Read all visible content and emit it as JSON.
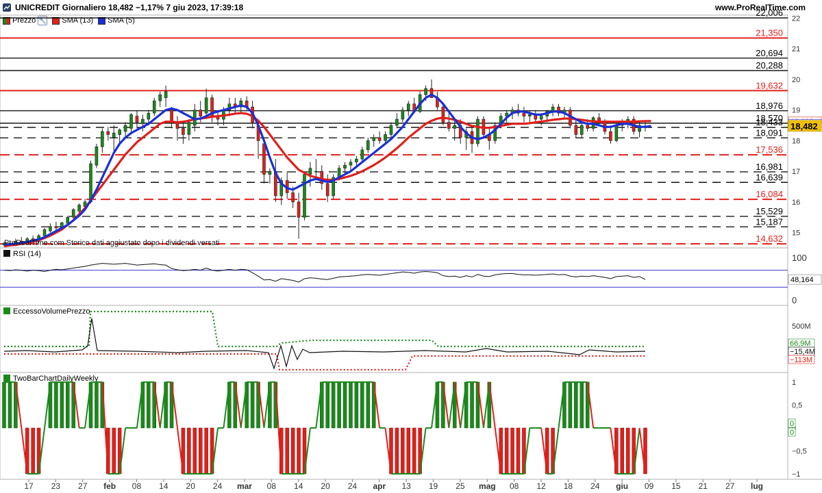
{
  "header": {
    "title": "UNICREDIT Giornaliero 18,482 −1,17% 7 giu 2023, 17:39:18",
    "site": "www.ProRealTime.com"
  },
  "legend": {
    "price": "Prezzo",
    "sma13": "SMA (13)",
    "sma5": "SMA (5)",
    "watermark": "ProRealTime.com Storico dati aggiustato dopo i dividendi versati"
  },
  "colors": {
    "up": "#1a8a1a",
    "down": "#e0201a",
    "sma13": "#e0201a",
    "sma5": "#1a2fd6",
    "current": "#f2c200"
  },
  "chart_data": [
    {
      "type": "candlestick",
      "title": "UNICREDIT Giornaliero",
      "ylim": [
        14.5,
        22.1
      ],
      "yticks": [
        15,
        16,
        17,
        18,
        19,
        20,
        21,
        22
      ],
      "last": "18,482",
      "x_labels": [
        "17",
        "23",
        "27",
        "feb",
        "08",
        "14",
        "20",
        "24",
        "mar",
        "08",
        "14",
        "20",
        "24",
        "apr",
        "13",
        "19",
        "25",
        "mag",
        "08",
        "12",
        "18",
        "24",
        "giu",
        "09",
        "15",
        "21",
        "27",
        "lug"
      ],
      "levels": [
        {
          "label": "22,006",
          "value": 22.006,
          "color": "black",
          "style": "solid"
        },
        {
          "label": "21,350",
          "value": 21.35,
          "color": "red",
          "style": "solid"
        },
        {
          "label": "20,694",
          "value": 20.694,
          "color": "black",
          "style": "solid"
        },
        {
          "label": "20,288",
          "value": 20.288,
          "color": "black",
          "style": "solid"
        },
        {
          "label": "19,632",
          "value": 19.632,
          "color": "red",
          "style": "solid"
        },
        {
          "label": "18,976",
          "value": 18.976,
          "color": "black",
          "style": "solid"
        },
        {
          "label": "18,570",
          "value": 18.57,
          "color": "black",
          "style": "solid"
        },
        {
          "label": "18,433",
          "value": 18.433,
          "color": "black",
          "style": "dashed"
        },
        {
          "label": "18,091",
          "value": 18.091,
          "color": "black",
          "style": "dashed"
        },
        {
          "label": "17,536",
          "value": 17.536,
          "color": "red",
          "style": "dashed"
        },
        {
          "label": "16,981",
          "value": 16.981,
          "color": "black",
          "style": "dashed"
        },
        {
          "label": "16,639",
          "value": 16.639,
          "color": "black",
          "style": "dashed"
        },
        {
          "label": "16,084",
          "value": 16.084,
          "color": "red",
          "style": "dashed"
        },
        {
          "label": "15,529",
          "value": 15.529,
          "color": "black",
          "style": "dashed"
        },
        {
          "label": "15,187",
          "value": 15.187,
          "color": "black",
          "style": "dashed"
        },
        {
          "label": "14,632",
          "value": 14.632,
          "color": "red",
          "style": "dashed"
        }
      ],
      "right_tags": [
        {
          "label": "18,638",
          "value": 18.638,
          "color": "#e0201a"
        },
        {
          "label": "18,638",
          "value": 18.56,
          "color": "#1a2fd6"
        }
      ],
      "ohlc": [
        [
          14.6,
          14.7,
          14.55,
          14.65
        ],
        [
          14.65,
          14.75,
          14.55,
          14.6
        ],
        [
          14.6,
          14.8,
          14.55,
          14.72
        ],
        [
          14.72,
          14.85,
          14.6,
          14.68
        ],
        [
          14.68,
          14.85,
          14.6,
          14.8
        ],
        [
          14.8,
          14.9,
          14.7,
          14.75
        ],
        [
          14.75,
          14.95,
          14.65,
          14.9
        ],
        [
          14.9,
          15.15,
          14.85,
          15.1
        ],
        [
          15.05,
          15.3,
          15.0,
          15.2
        ],
        [
          15.2,
          15.35,
          15.05,
          15.15
        ],
        [
          15.15,
          15.35,
          15.1,
          15.32
        ],
        [
          15.3,
          15.55,
          15.25,
          15.5
        ],
        [
          15.5,
          15.8,
          15.45,
          15.75
        ],
        [
          15.7,
          15.95,
          15.55,
          15.9
        ],
        [
          15.85,
          16.1,
          15.8,
          16.0
        ],
        [
          16.0,
          17.35,
          15.95,
          17.25
        ],
        [
          17.2,
          17.9,
          17.1,
          17.8
        ],
        [
          17.8,
          18.4,
          17.6,
          18.3
        ],
        [
          18.3,
          18.45,
          18.0,
          18.2
        ],
        [
          18.1,
          18.5,
          17.6,
          18.25
        ],
        [
          18.2,
          18.4,
          17.9,
          18.35
        ],
        [
          18.3,
          18.6,
          18.1,
          18.5
        ],
        [
          18.4,
          18.9,
          18.2,
          18.85
        ],
        [
          18.8,
          19.0,
          18.4,
          18.6
        ],
        [
          18.55,
          18.85,
          18.3,
          18.7
        ],
        [
          18.7,
          19.0,
          18.5,
          18.9
        ],
        [
          18.9,
          19.4,
          18.8,
          19.3
        ],
        [
          19.3,
          19.6,
          19.1,
          19.5
        ],
        [
          19.4,
          19.8,
          19.1,
          19.6
        ],
        [
          19.0,
          19.1,
          18.4,
          18.6
        ],
        [
          18.6,
          18.8,
          18.0,
          18.4
        ],
        [
          18.4,
          18.6,
          17.9,
          18.2
        ],
        [
          18.2,
          18.7,
          18.0,
          18.6
        ],
        [
          18.5,
          19.2,
          18.3,
          19.0
        ],
        [
          19.0,
          19.3,
          18.6,
          18.8
        ],
        [
          18.9,
          19.7,
          18.7,
          19.4
        ],
        [
          19.4,
          19.5,
          18.6,
          18.8
        ],
        [
          18.8,
          19.0,
          18.5,
          18.7
        ],
        [
          18.7,
          19.1,
          18.5,
          19.0
        ],
        [
          19.0,
          19.4,
          18.8,
          19.2
        ],
        [
          19.2,
          19.4,
          18.9,
          19.1
        ],
        [
          19.1,
          19.4,
          18.9,
          19.3
        ],
        [
          19.3,
          19.45,
          19.0,
          19.1
        ],
        [
          19.1,
          19.3,
          18.4,
          18.6
        ],
        [
          18.5,
          18.7,
          17.4,
          18.0
        ],
        [
          17.9,
          18.1,
          16.6,
          16.9
        ],
        [
          16.9,
          17.1,
          16.6,
          17.0
        ],
        [
          17.0,
          17.4,
          16.0,
          16.2
        ],
        [
          16.2,
          16.8,
          15.9,
          16.7
        ],
        [
          16.7,
          17.0,
          16.1,
          16.3
        ],
        [
          16.3,
          16.5,
          15.8,
          16.0
        ],
        [
          16.0,
          16.3,
          14.8,
          15.5
        ],
        [
          15.5,
          17.0,
          15.4,
          16.9
        ],
        [
          16.9,
          17.3,
          16.5,
          17.1
        ],
        [
          17.0,
          17.4,
          16.8,
          17.0
        ],
        [
          17.0,
          17.2,
          16.4,
          16.6
        ],
        [
          16.6,
          16.9,
          16.0,
          16.2
        ],
        [
          16.2,
          16.9,
          16.1,
          16.8
        ],
        [
          16.8,
          17.2,
          16.7,
          17.1
        ],
        [
          17.1,
          17.3,
          16.9,
          17.2
        ],
        [
          17.2,
          17.4,
          17.0,
          17.3
        ],
        [
          17.3,
          17.5,
          17.1,
          17.4
        ],
        [
          17.4,
          17.8,
          17.3,
          17.7
        ],
        [
          17.7,
          18.1,
          17.6,
          18.0
        ],
        [
          18.0,
          18.2,
          17.8,
          18.1
        ],
        [
          18.1,
          18.3,
          17.9,
          18.0
        ],
        [
          18.0,
          18.3,
          17.9,
          18.2
        ],
        [
          18.2,
          18.6,
          18.1,
          18.5
        ],
        [
          18.5,
          18.9,
          18.4,
          18.7
        ],
        [
          18.7,
          19.1,
          18.6,
          19.0
        ],
        [
          19.0,
          19.3,
          18.8,
          19.2
        ],
        [
          19.2,
          19.4,
          18.9,
          18.95
        ],
        [
          18.95,
          19.6,
          18.9,
          19.5
        ],
        [
          19.5,
          19.8,
          19.3,
          19.7
        ],
        [
          19.7,
          20.0,
          19.4,
          19.4
        ],
        [
          19.4,
          19.6,
          19.0,
          19.1
        ],
        [
          19.1,
          19.2,
          18.5,
          18.6
        ],
        [
          18.6,
          18.9,
          18.3,
          18.4
        ],
        [
          18.4,
          18.7,
          18.0,
          18.5
        ],
        [
          18.5,
          18.7,
          17.9,
          18.1
        ],
        [
          18.1,
          18.4,
          17.7,
          18.3
        ],
        [
          18.3,
          18.5,
          17.6,
          17.9
        ],
        [
          17.9,
          18.8,
          17.8,
          18.7
        ],
        [
          18.7,
          18.8,
          18.1,
          18.2
        ],
        [
          18.2,
          18.4,
          17.7,
          18.0
        ],
        [
          18.0,
          18.6,
          17.9,
          18.5
        ],
        [
          18.5,
          18.9,
          18.4,
          18.8
        ],
        [
          18.8,
          19.0,
          18.6,
          18.9
        ],
        [
          18.9,
          19.1,
          18.7,
          19.0
        ],
        [
          19.0,
          19.2,
          18.8,
          18.9
        ],
        [
          18.9,
          19.1,
          18.6,
          18.8
        ],
        [
          18.8,
          19.0,
          18.6,
          18.85
        ],
        [
          18.85,
          19.0,
          18.6,
          18.7
        ],
        [
          18.7,
          18.9,
          18.5,
          18.8
        ],
        [
          18.8,
          19.0,
          18.6,
          18.95
        ],
        [
          18.95,
          19.2,
          18.8,
          19.1
        ],
        [
          19.1,
          19.2,
          18.8,
          18.9
        ],
        [
          18.9,
          19.1,
          18.7,
          19.0
        ],
        [
          19.0,
          19.1,
          18.4,
          18.5
        ],
        [
          18.5,
          18.7,
          18.1,
          18.2
        ],
        [
          18.2,
          18.6,
          18.1,
          18.5
        ],
        [
          18.5,
          18.7,
          18.3,
          18.4
        ],
        [
          18.4,
          18.8,
          18.3,
          18.75
        ],
        [
          18.75,
          18.9,
          18.5,
          18.6
        ],
        [
          18.6,
          18.7,
          18.2,
          18.3
        ],
        [
          18.3,
          18.5,
          17.9,
          18.0
        ],
        [
          18.0,
          18.6,
          17.95,
          18.5
        ],
        [
          18.5,
          18.7,
          18.3,
          18.6
        ],
        [
          18.6,
          18.8,
          18.4,
          18.7
        ],
        [
          18.7,
          18.8,
          18.2,
          18.3
        ],
        [
          18.3,
          18.6,
          18.1,
          18.5
        ],
        [
          18.48,
          18.65,
          18.3,
          18.482
        ]
      ],
      "sma13": [
        14.55,
        14.58,
        14.6,
        14.63,
        14.66,
        14.7,
        14.75,
        14.82,
        14.9,
        15.0,
        15.1,
        15.25,
        15.4,
        15.6,
        15.8,
        16.05,
        16.3,
        16.55,
        16.8,
        17.05,
        17.3,
        17.55,
        17.75,
        17.95,
        18.1,
        18.25,
        18.4,
        18.55,
        18.62,
        18.62,
        18.6,
        18.62,
        18.65,
        18.7,
        18.72,
        18.75,
        18.78,
        18.8,
        18.82,
        18.85,
        18.88,
        18.9,
        18.88,
        18.8,
        18.65,
        18.45,
        18.2,
        17.95,
        17.7,
        17.45,
        17.25,
        17.05,
        16.95,
        16.85,
        16.8,
        16.75,
        16.72,
        16.72,
        16.75,
        16.8,
        16.85,
        16.92,
        17.0,
        17.1,
        17.2,
        17.32,
        17.45,
        17.6,
        17.75,
        17.92,
        18.1,
        18.25,
        18.4,
        18.55,
        18.65,
        18.72,
        18.75,
        18.72,
        18.68,
        18.62,
        18.55,
        18.48,
        18.45,
        18.42,
        18.42,
        18.45,
        18.48,
        18.52,
        18.55,
        18.55,
        18.55,
        18.57,
        18.6,
        18.62,
        18.65,
        18.68,
        18.7,
        18.72,
        18.72,
        18.7,
        18.68,
        18.65,
        18.63,
        18.62,
        18.62,
        18.62,
        18.62,
        18.62,
        18.62,
        18.62,
        18.63,
        18.64,
        18.638
      ],
      "sma5": [
        14.6,
        14.62,
        14.64,
        14.66,
        14.7,
        14.74,
        14.78,
        14.85,
        14.95,
        15.05,
        15.15,
        15.25,
        15.4,
        15.55,
        15.75,
        16.05,
        16.4,
        16.8,
        17.2,
        17.6,
        17.9,
        18.1,
        18.25,
        18.35,
        18.45,
        18.55,
        18.7,
        18.85,
        19.0,
        19.05,
        19.0,
        18.9,
        18.8,
        18.7,
        18.72,
        18.8,
        18.9,
        18.95,
        19.0,
        19.05,
        19.1,
        19.15,
        19.1,
        18.9,
        18.5,
        18.0,
        17.45,
        16.95,
        16.6,
        16.45,
        16.4,
        16.5,
        16.6,
        16.7,
        16.75,
        16.7,
        16.65,
        16.7,
        16.8,
        16.9,
        17.0,
        17.15,
        17.3,
        17.45,
        17.6,
        17.75,
        17.9,
        18.05,
        18.25,
        18.45,
        18.7,
        18.95,
        19.2,
        19.4,
        19.5,
        19.4,
        19.2,
        18.95,
        18.7,
        18.45,
        18.25,
        18.1,
        18.05,
        18.1,
        18.2,
        18.35,
        18.55,
        18.75,
        18.9,
        18.95,
        18.95,
        18.9,
        18.85,
        18.85,
        18.9,
        18.95,
        18.95,
        18.9,
        18.8,
        18.7,
        18.6,
        18.55,
        18.55,
        18.5,
        18.45,
        18.45,
        18.5,
        18.55,
        18.55,
        18.5,
        18.45,
        18.45,
        18.48
      ]
    },
    {
      "type": "line",
      "title": "RSI (14)",
      "ylim": [
        0,
        100
      ],
      "yticks": [
        0,
        100
      ],
      "last": "48,164",
      "bands": [
        70,
        30
      ],
      "values": [
        70,
        69,
        71,
        70,
        68,
        70,
        69,
        67,
        70,
        72,
        71,
        73,
        75,
        77,
        79,
        82,
        84,
        86,
        85,
        84,
        85,
        86,
        84,
        82,
        83,
        84,
        85,
        83,
        82,
        74,
        71,
        69,
        70,
        72,
        70,
        75,
        70,
        68,
        70,
        72,
        70,
        72,
        71,
        64,
        56,
        47,
        48,
        44,
        50,
        48,
        46,
        42,
        50,
        52,
        51,
        49,
        48,
        51,
        54,
        55,
        56,
        57,
        59,
        60,
        59,
        58,
        60,
        62,
        64,
        66,
        65,
        63,
        66,
        67,
        66,
        64,
        57,
        55,
        56,
        53,
        57,
        54,
        60,
        56,
        55,
        59,
        61,
        62,
        62,
        60,
        59,
        59,
        58,
        59,
        60,
        61,
        59,
        60,
        56,
        54,
        56,
        55,
        57,
        55,
        53,
        50,
        55,
        56,
        57,
        53,
        55,
        48.164
      ]
    },
    {
      "type": "line",
      "title": "EccessoVolumePrezzo",
      "yticks": [
        "500M"
      ],
      "tags": [
        "66,9M",
        "−15,4M",
        "−113M"
      ]
    },
    {
      "type": "bar",
      "title": "TwoBarChartDailyWeekly",
      "ylim": [
        -1,
        1
      ],
      "yticks": [
        "1",
        "0,5",
        "0",
        "−0,5",
        "−1"
      ],
      "tags": [
        "0",
        "0"
      ]
    }
  ]
}
